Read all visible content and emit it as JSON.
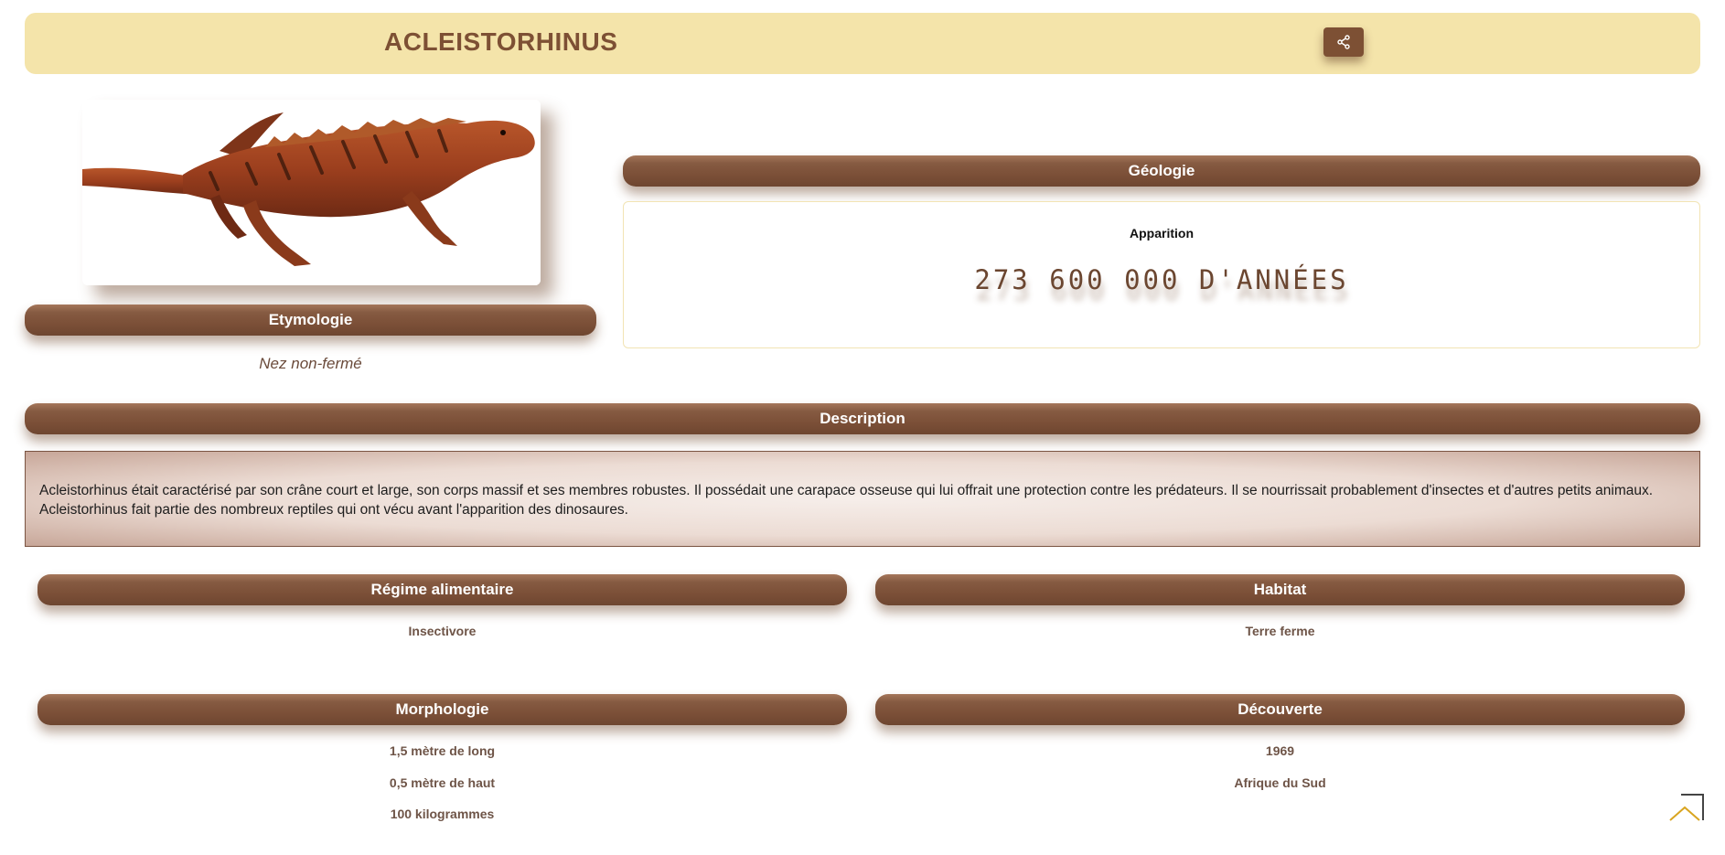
{
  "header": {
    "title": "ACLEISTORHINUS",
    "share_icon": "share-icon"
  },
  "image": {
    "alt": "Acleistorhinus"
  },
  "etymology": {
    "heading": "Etymologie",
    "text": "Nez non-fermé"
  },
  "geology": {
    "heading": "Géologie",
    "label": "Apparition",
    "value": "273 600 000 D'ANNÉES"
  },
  "description": {
    "heading": "Description",
    "line1": "Acleistorhinus était caractérisé par son crâne court et large, son corps massif et ses membres robustes. Il possédait une carapace osseuse qui lui offrait une protection contre les prédateurs. Il se nourrissait probablement d'insectes et d'autres petits animaux.",
    "line2": "Acleistorhinus fait partie des nombreux reptiles qui ont vécu avant l'apparition des dinosaures."
  },
  "diet": {
    "heading": "Régime alimentaire",
    "value": "Insectivore"
  },
  "habitat": {
    "heading": "Habitat",
    "value": "Terre ferme"
  },
  "morphology": {
    "heading": "Morphologie",
    "length": "1,5 mètre de long",
    "height": "0,5 mètre de haut",
    "weight": "100 kilogrammes"
  },
  "discovery": {
    "heading": "Découverte",
    "year": "1969",
    "place": "Afrique du Sud"
  },
  "colors": {
    "brown": "#7d5034",
    "cream": "#f4e4aa",
    "gold": "#d9a520"
  },
  "back_to_top_icon": "chevron-up-icon"
}
